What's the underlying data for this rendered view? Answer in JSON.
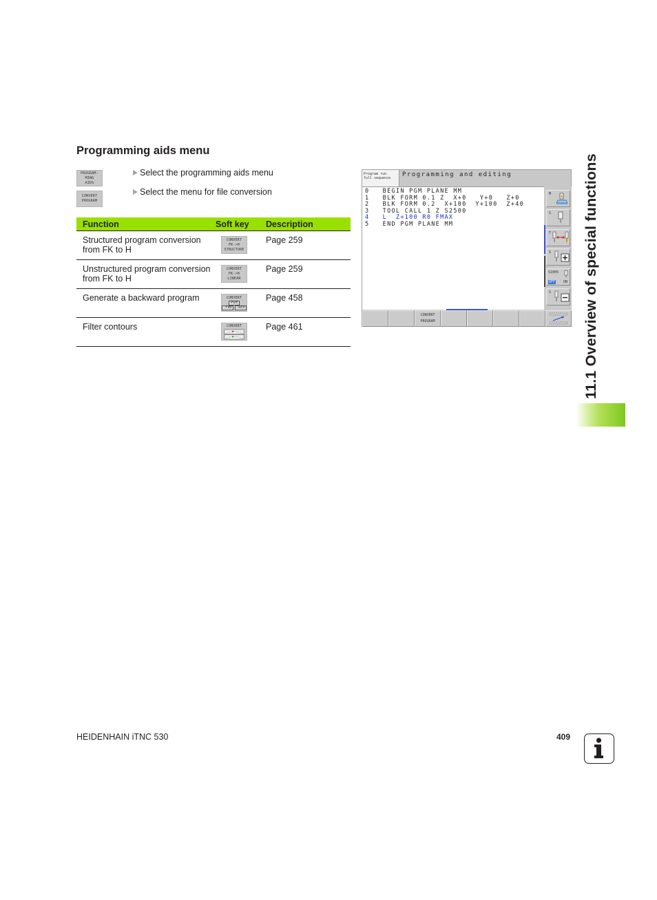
{
  "section": {
    "title": "Programming aids menu"
  },
  "steps": [
    {
      "softkey_lines": [
        "PROGRAM-",
        "MING",
        "AIDS"
      ],
      "text": "Select the programming aids menu"
    },
    {
      "softkey_lines": [
        "CONVERT",
        "PROGRAM"
      ],
      "text": "Select the menu for file conversion"
    }
  ],
  "table": {
    "headers": {
      "function": "Function",
      "softkey": "Soft key",
      "description": "Description"
    },
    "header_color": "#99e000",
    "rows": [
      {
        "function": "Structured program conversion from FK to H",
        "softkey_lines": [
          "CONVERT",
          "FK->H",
          "STRUCTURE"
        ],
        "description": "Page 259"
      },
      {
        "function": "Unstructured program conversion from FK to H",
        "softkey_lines": [
          "CONVERT",
          "FK->H",
          "LINEAR"
        ],
        "description": "Page 259"
      },
      {
        "function": "Generate a backward program",
        "softkey_lines": [
          "CONVERT",
          "PGM",
          ".FWD",
          ".REV"
        ],
        "description": "Page 458"
      },
      {
        "function": "Filter contours",
        "softkey_lines": [
          "CONVERT"
        ],
        "description": "Page 461"
      }
    ]
  },
  "tnc_screen": {
    "mode_small": [
      "Program run",
      "full sequence"
    ],
    "mode_big": "Programming and editing",
    "program_lines": [
      {
        "text": "0   BEGIN PGM PLANE MM",
        "active": false
      },
      {
        "text": "1   BLK FORM 0.1 Z  X+0   Y+0   Z+0",
        "active": false
      },
      {
        "text": "2   BLK FORM 0.2  X+100  Y+100  Z+40",
        "active": false
      },
      {
        "text": "3   TOOL CALL 1 Z S2500",
        "active": false
      },
      {
        "text": "4   L  Z+100 R0 FMAX",
        "active": true
      },
      {
        "text": "5   END PGM PLANE MM",
        "active": false
      }
    ],
    "side_softkeys": [
      {
        "label": "M",
        "icon": "machine-table-icon"
      },
      {
        "label": "S",
        "icon": "spindle-icon"
      },
      {
        "label": "T",
        "icon": "tool-change-icon"
      },
      {
        "label": "S",
        "icon": "spindle-plus-icon"
      },
      {
        "label": "S100%",
        "off": "OFF",
        "on": "ON",
        "icon": "spindle-override-icon"
      },
      {
        "label": "S",
        "icon": "spindle-minus-icon"
      }
    ],
    "bottom_softkeys": [
      "",
      "",
      "CONVERT PROGRAM",
      "",
      "",
      "",
      "",
      ""
    ],
    "accent_color": "#1a2ecc"
  },
  "side_tab": {
    "title": "11.1 Overview of special functions",
    "bar_color": "#7ec81e"
  },
  "footer": {
    "manual": "HEIDENHAIN iTNC 530",
    "page": "409",
    "info_icon_glyph": "i"
  }
}
